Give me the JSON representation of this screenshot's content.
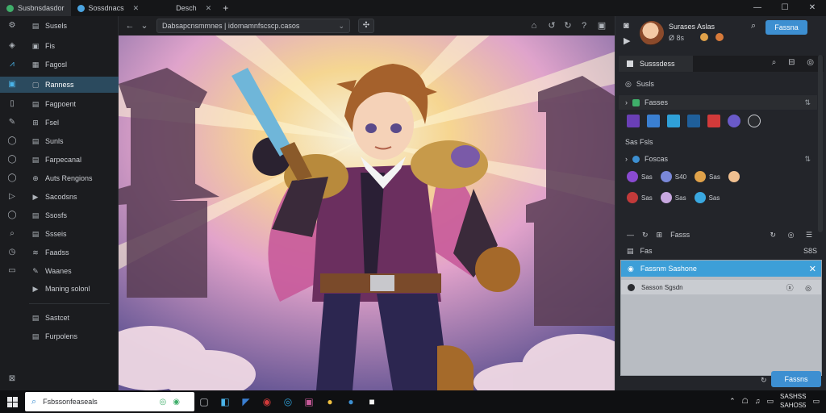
{
  "tabs": [
    {
      "label": "Susbnsdasdor",
      "active": true
    },
    {
      "label": "Sossdnacs",
      "active": false
    },
    {
      "label": "Desch",
      "active": false
    }
  ],
  "sidebar": {
    "items": [
      {
        "label": "Susels",
        "icon": "settings-icon",
        "icon2": "file-icon"
      },
      {
        "label": "Fis",
        "icon": "tag-icon",
        "icon2": "folder-icon"
      },
      {
        "label": "Fagosl",
        "icon": "chart-icon",
        "icon2": "image-icon"
      },
      {
        "label": "Ranness",
        "icon": "layers-icon",
        "icon2": "box-icon",
        "selected": true
      },
      {
        "label": "Fagpoent",
        "icon": "book-icon",
        "icon2": "book-icon"
      },
      {
        "label": "Fsel",
        "icon": "chat-icon",
        "icon2": "grid-icon"
      },
      {
        "label": "Sunls",
        "icon": "circle-icon",
        "icon2": "doc-icon"
      },
      {
        "label": "Farpecanal",
        "icon": "user-icon",
        "icon2": "note-icon"
      },
      {
        "label": "Auts Rengions",
        "icon": "shield-icon",
        "icon2": "globe-icon"
      },
      {
        "label": "Sacodsns",
        "icon": "play-icon",
        "icon2": "play-icon"
      },
      {
        "label": "Ssosfs",
        "icon": "home-icon",
        "icon2": "doc-icon"
      },
      {
        "label": "Ssseis",
        "icon": "link-icon",
        "icon2": "note-icon"
      },
      {
        "label": "Faadss",
        "icon": "clock-icon",
        "icon2": "layers-icon"
      },
      {
        "label": "Waanes",
        "icon": "box-icon",
        "icon2": "edit-icon"
      },
      {
        "label": "Maning solonl",
        "icon": "",
        "icon2": "play-icon"
      },
      {
        "label": "Sastcet",
        "icon": "",
        "icon2": "note-icon"
      },
      {
        "label": "Furpolens",
        "icon": "",
        "icon2": "note-icon"
      }
    ]
  },
  "toolbar": {
    "address": "Dabsapcnsmmnes | idomamnfscscp.casos"
  },
  "right_panel": {
    "user_name": "Surases Aslas",
    "user_sub": "Ø 8s",
    "primary_button": "Fassna",
    "tab_label": "Susssdess",
    "section1_title": "Susls",
    "band1_label": "Fasses",
    "section2_title": "Sas Fsls",
    "band2_label": "Foscas",
    "grid_row1": [
      "Sas",
      "S40",
      "Sas"
    ],
    "grid_row2": [
      "Sas",
      "Sas",
      "Sas"
    ],
    "list_head": "Fasss",
    "list_sub": "Fas",
    "list_sub_right": "S8S",
    "selected_row": "Fassnm Sashone",
    "row2": "Sasson Sgsdn",
    "footer_button": "Fassns"
  },
  "taskbar": {
    "search_text": "Fsbssonfeaseals",
    "time": "SASHSS",
    "date": "SAHOS5"
  },
  "colors": {
    "accent": "#3d8fd1",
    "selection": "#3d9fd8",
    "sidebar_selected": "#2b4a5e"
  }
}
